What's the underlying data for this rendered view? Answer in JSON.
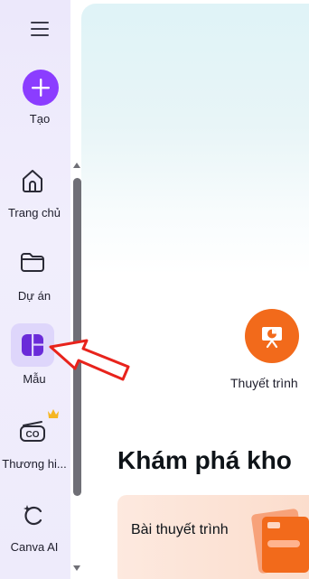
{
  "nav": {
    "create_label": "Tạo",
    "items": [
      {
        "label": "Trang chủ",
        "icon": "home-icon"
      },
      {
        "label": "Dự án",
        "icon": "folder-icon"
      },
      {
        "label": "Mẫu",
        "icon": "templates-icon",
        "active": true
      },
      {
        "label": "Thương hi...",
        "icon": "brand-icon",
        "badge": "crown-icon"
      },
      {
        "label": "Canva AI",
        "icon": "ai-sparkle-icon"
      }
    ]
  },
  "main": {
    "design_type_label": "Thuyết trình",
    "section_title": "Khám phá kho",
    "card_label": "Bài thuyết trình"
  },
  "colors": {
    "accent": "#8b3dff",
    "active_bg": "#ded6fb",
    "presentation_orange": "#f26a1b",
    "annotation_red": "#e8231c"
  }
}
